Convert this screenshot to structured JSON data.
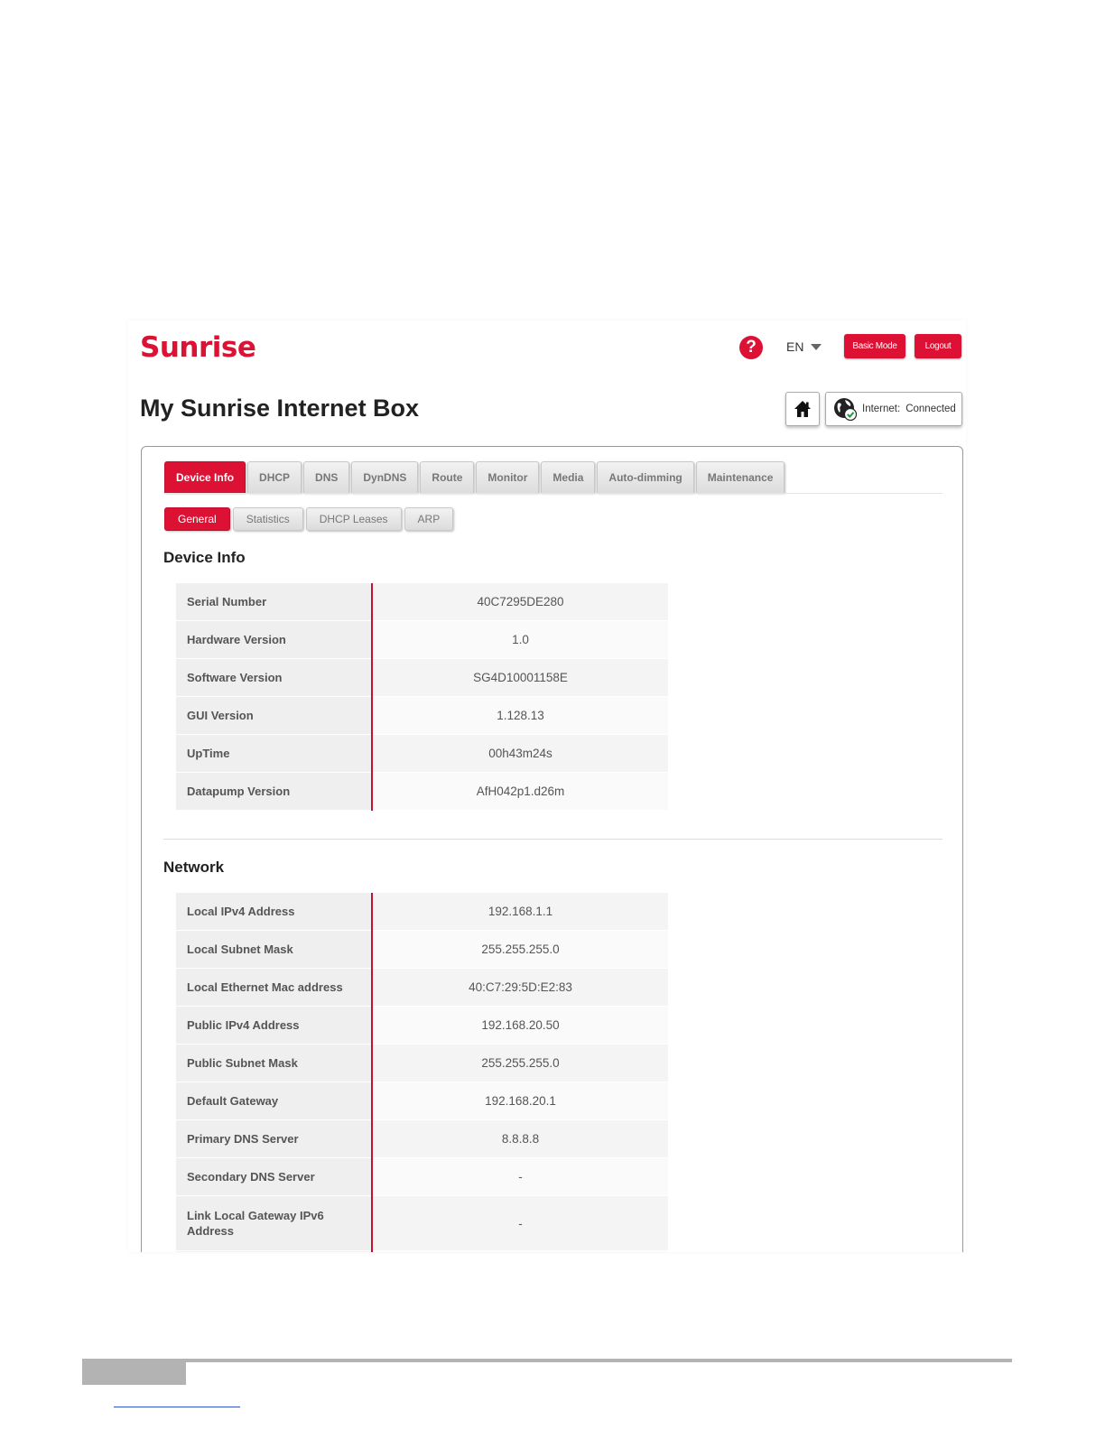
{
  "header": {
    "logo": "Sunrise",
    "help_symbol": "?",
    "language": "EN",
    "basic_mode_label": "Basic Mode",
    "logout_label": "Logout"
  },
  "page": {
    "title": "My Sunrise Internet Box",
    "internet_label": "Internet:",
    "internet_status": "Connected"
  },
  "tabs": [
    "Device Info",
    "DHCP",
    "DNS",
    "DynDNS",
    "Route",
    "Monitor",
    "Media",
    "Auto-dimming",
    "Maintenance"
  ],
  "active_tab": "Device Info",
  "subtabs": [
    "General",
    "Statistics",
    "DHCP Leases",
    "ARP"
  ],
  "active_subtab": "General",
  "device_info": {
    "title": "Device Info",
    "rows": [
      {
        "label": "Serial Number",
        "value": "40C7295DE280"
      },
      {
        "label": "Hardware Version",
        "value": "1.0"
      },
      {
        "label": "Software Version",
        "value": "SG4D10001158E"
      },
      {
        "label": "GUI Version",
        "value": "1.128.13"
      },
      {
        "label": "UpTime",
        "value": "00h43m24s"
      },
      {
        "label": "Datapump Version",
        "value": "AfH042p1.d26m"
      }
    ]
  },
  "network": {
    "title": "Network",
    "rows": [
      {
        "label": "Local IPv4 Address",
        "value": "192.168.1.1"
      },
      {
        "label": "Local Subnet Mask",
        "value": "255.255.255.0"
      },
      {
        "label": "Local Ethernet Mac address",
        "value": "40:C7:29:5D:E2:83"
      },
      {
        "label": "Public IPv4 Address",
        "value": "192.168.20.50"
      },
      {
        "label": "Public Subnet Mask",
        "value": "255.255.255.0"
      },
      {
        "label": "Default Gateway",
        "value": "192.168.20.1"
      },
      {
        "label": "Primary DNS Server",
        "value": "8.8.8.8"
      },
      {
        "label": "Secondary DNS Server",
        "value": "-"
      },
      {
        "label": "Link Local Gateway IPv6 Address",
        "value": "-"
      }
    ]
  },
  "colors": {
    "brand_red": "#dd1133",
    "row_divider_red": "#c8102e"
  },
  "icons": {
    "help": "question-circle-icon",
    "language_caret": "caret-down-icon",
    "home": "home-icon",
    "internet": "globe-check-icon"
  }
}
